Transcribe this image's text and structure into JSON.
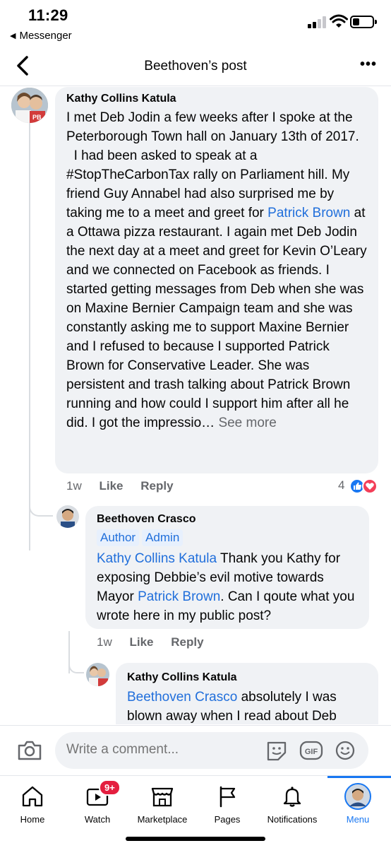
{
  "status": {
    "time": "11:29",
    "back_label": "Messenger"
  },
  "header": {
    "title": "Beethoven’s post"
  },
  "comments": [
    {
      "author": "Kathy Collins Katula",
      "segments": [
        {
          "text": "I met Deb Jodin a few weeks after I spoke at the Peterborough Town hall on January 13th of 2017.",
          "type": "plain"
        },
        {
          "text": "  I had been asked to speak at a #StopTheCarbonTax rally on Parliament hill. My friend Guy Annabel had also surprised me by taking me to a meet and greet for ",
          "type": "plain"
        },
        {
          "text": "Patrick Brown",
          "type": "link"
        },
        {
          "text": " at a Ottawa pizza restaurant. I again met Deb Jodin the next day at a meet and greet for Kevin O’Leary and we connected on Facebook as friends. I started getting messages from Deb when she was on Maxine Bernier Campaign team and she was constantly asking me to support Maxine Bernier and I refused to because I supported Patrick Brown for Conservative Leader. She was persistent and trash talking about Patrick Brown running and how could I support him after all he did. I got the impressio… ",
          "type": "plain"
        },
        {
          "text": "See more",
          "type": "see_more"
        }
      ],
      "time": "1w",
      "like_label": "Like",
      "reply_label": "Reply",
      "reaction_count": "4"
    },
    {
      "author": "Beethoven Crasco",
      "badges": [
        "Author",
        "Admin"
      ],
      "mention": "Kathy Collins Katula",
      "text_a": " Thank you Kathy for exposing Debbie’s evil motive towards Mayor ",
      "link2": "Patrick Brown",
      "text_b": ". Can I qoute what you wrote here in my public post?",
      "time": "1w",
      "like_label": "Like",
      "reply_label": "Reply"
    },
    {
      "author": "Kathy Collins Katula",
      "mention": "Beethoven Crasco",
      "text": " absolutely I was blown away when I read about Deb"
    }
  ],
  "composer": {
    "placeholder": "Write a comment...",
    "icons": [
      "camera-icon",
      "sticker-icon",
      "gif-icon",
      "emoji-icon"
    ]
  },
  "tabs": [
    {
      "label": "Home",
      "icon": "home-icon"
    },
    {
      "label": "Watch",
      "icon": "watch-icon",
      "badge": "9+"
    },
    {
      "label": "Marketplace",
      "icon": "marketplace-icon"
    },
    {
      "label": "Pages",
      "icon": "pages-icon"
    },
    {
      "label": "Notifications",
      "icon": "bell-icon"
    },
    {
      "label": "Menu",
      "icon": "profile-avatar",
      "active": true
    }
  ],
  "colors": {
    "accent": "#1877f2",
    "link": "#216fdb",
    "bubble": "#f0f2f5",
    "badge_red": "#e41e3f"
  }
}
